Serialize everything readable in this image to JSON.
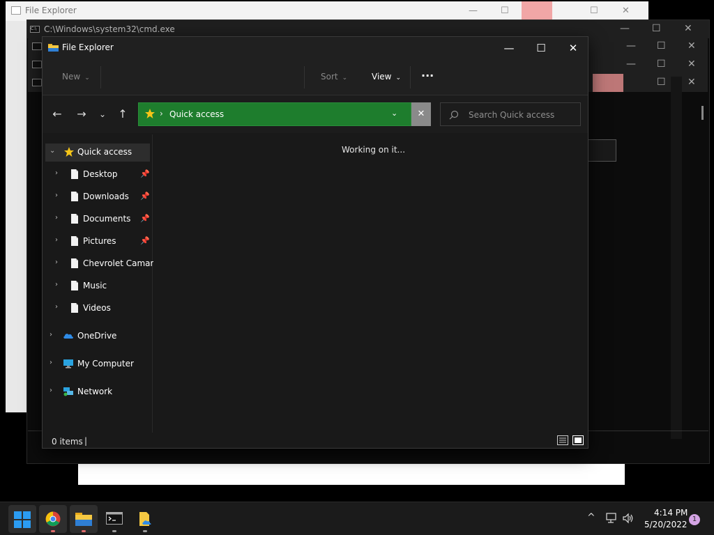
{
  "bg_window": {
    "title": "File Explorer"
  },
  "cmd_window": {
    "title": "C:\\Windows\\system32\\cmd.exe"
  },
  "explorer": {
    "title": "File Explorer",
    "toolbar": {
      "new_label": "New",
      "sort_label": "Sort",
      "view_label": "View",
      "more_label": "···"
    },
    "address": {
      "location": "Quick access",
      "separator": "›"
    },
    "search": {
      "placeholder": "Search Quick access"
    },
    "sidebar": {
      "quick_access": "Quick access",
      "items": [
        {
          "label": "Desktop",
          "pinned": true
        },
        {
          "label": "Downloads",
          "pinned": true
        },
        {
          "label": "Documents",
          "pinned": true
        },
        {
          "label": "Pictures",
          "pinned": true
        },
        {
          "label": "Chevrolet Camaro",
          "pinned": false
        },
        {
          "label": "Music",
          "pinned": false
        },
        {
          "label": "Videos",
          "pinned": false
        }
      ],
      "roots": [
        {
          "label": "OneDrive",
          "icon": "onedrive-icon"
        },
        {
          "label": "My Computer",
          "icon": "computer-icon"
        },
        {
          "label": "Network",
          "icon": "network-icon"
        }
      ]
    },
    "content": {
      "status_message": "Working on it..."
    },
    "statusbar": {
      "item_count": "0 items"
    }
  },
  "taskbar": {
    "apps": [
      "start-icon",
      "chrome-icon",
      "file-explorer-icon",
      "terminal-icon",
      "folder-cloud-icon"
    ],
    "clock": {
      "time": "4:14 PM",
      "date": "5/20/2022"
    },
    "notification_count": "1"
  },
  "colors": {
    "address_bar": "#1e7d2d",
    "explorer_bg": "#191919",
    "taskbar_bg": "#1b1b1b"
  }
}
